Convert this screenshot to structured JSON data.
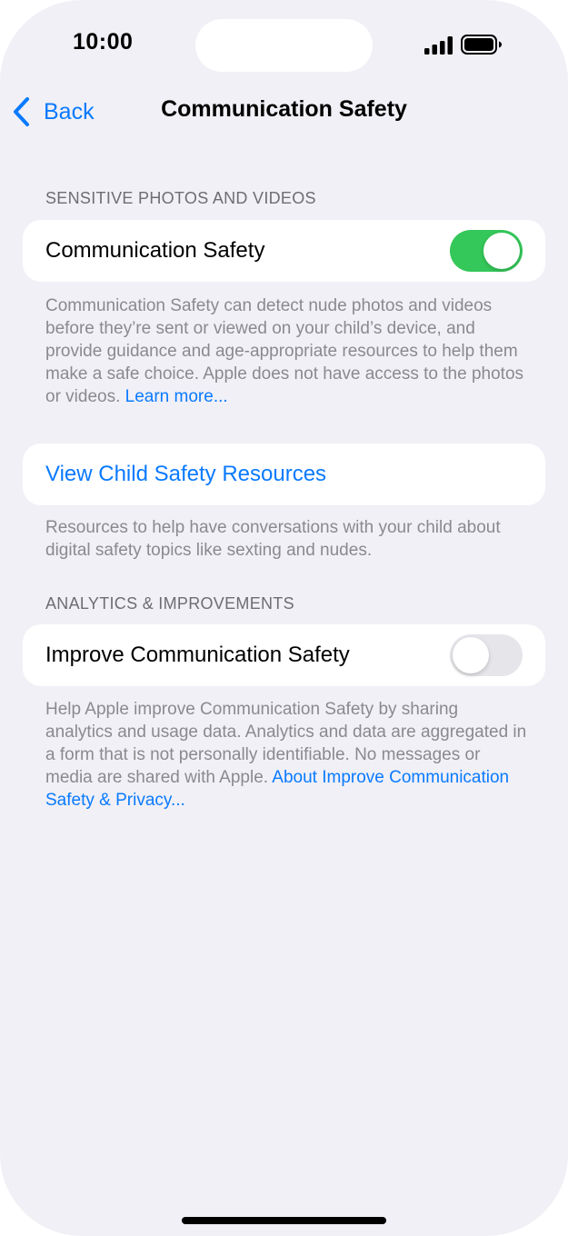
{
  "status_bar": {
    "time": "10:00",
    "signal_icon": "cellular-signal-icon",
    "battery_icon": "battery-full-icon"
  },
  "nav": {
    "back_label": "Back",
    "back_icon": "chevron-left-icon",
    "title": "Communication Safety"
  },
  "sections": {
    "sensitive": {
      "header": "SENSITIVE PHOTOS AND VIDEOS",
      "row_label": "Communication Safety",
      "toggle_on": true,
      "footer_text": "Communication Safety can detect nude photos and videos before they’re sent or viewed on your child’s device, and provide guidance and age-appropriate resources to help them make a safe choice. Apple does not have access to the photos or videos.",
      "footer_link": "Learn more..."
    },
    "resources": {
      "row_label": "View Child Safety Resources",
      "footer_text": "Resources to help have conversations with your child about digital safety topics like sexting and nudes."
    },
    "analytics": {
      "header": "ANALYTICS & IMPROVEMENTS",
      "row_label": "Improve Communication Safety",
      "toggle_on": false,
      "footer_text": "Help Apple improve Communication Safety by sharing analytics and usage data. Analytics and data are aggregated in a form that is not personally identifiable. No messages or media are shared with Apple.",
      "footer_link": "About Improve Communication Safety & Privacy..."
    }
  },
  "colors": {
    "background": "#f0f0f6",
    "accent": "#0a7aff",
    "toggle_on": "#34c759",
    "toggle_off": "#e6e6ea"
  }
}
